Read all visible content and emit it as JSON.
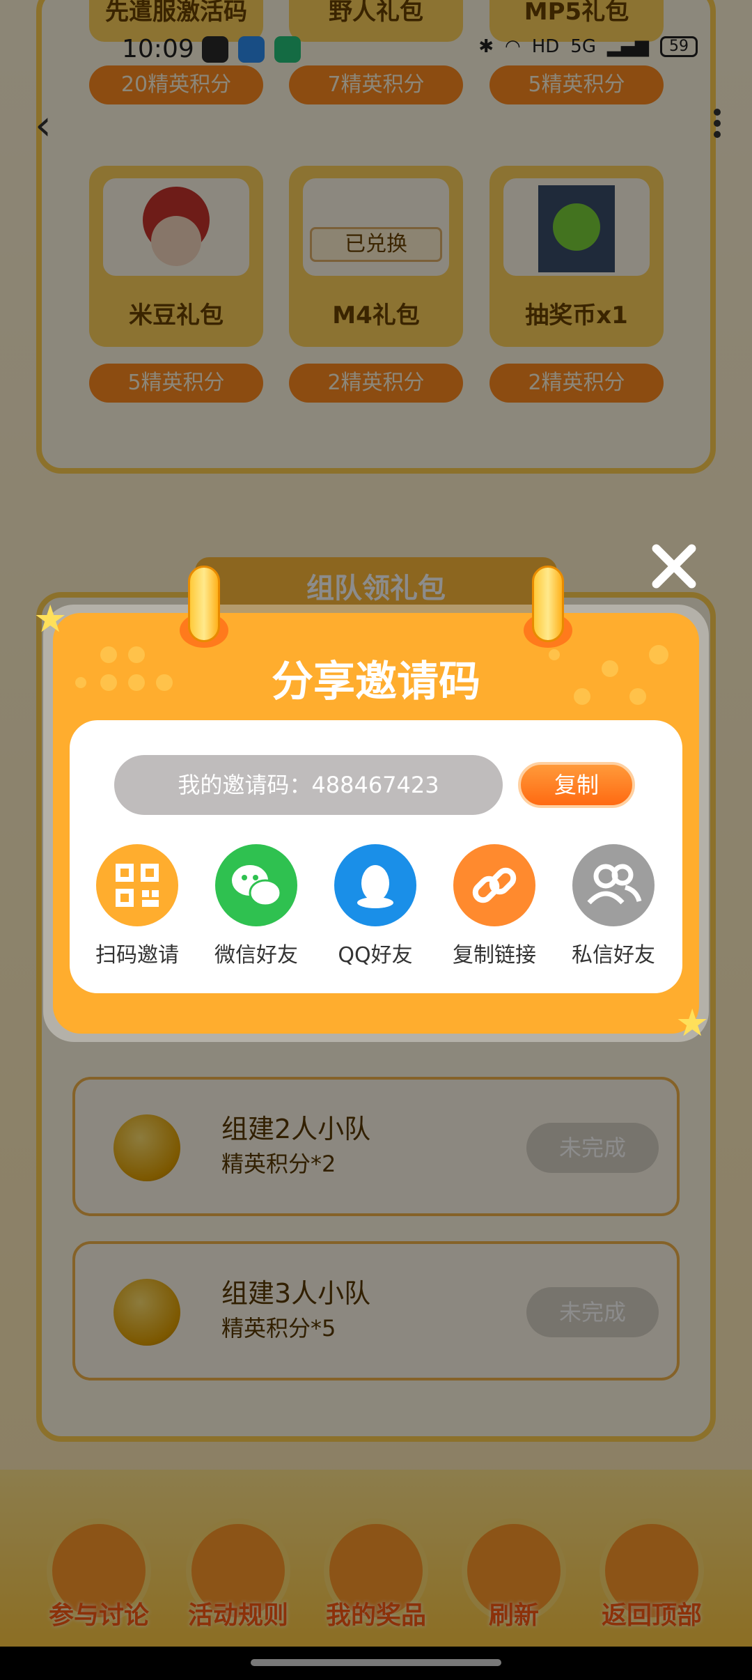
{
  "status_bar": {
    "time": "10:09",
    "network": "5G",
    "hd": "HD",
    "battery": "59"
  },
  "gift_top_row": [
    {
      "title": "先遣服激活码",
      "points": "20精英积分"
    },
    {
      "title": "野人礼包",
      "points": "7精英积分"
    },
    {
      "title": "MP5礼包",
      "points": "5精英积分"
    }
  ],
  "gift_row": [
    {
      "title": "米豆礼包",
      "points": "5精英积分"
    },
    {
      "title": "M4礼包",
      "points": "2精英积分",
      "tag": "已兑换"
    },
    {
      "title": "抽奖币x1",
      "points": "2精英积分"
    }
  ],
  "team_section": {
    "title": "组队领礼包",
    "tasks": [
      {
        "name": "组建2人小队",
        "reward": "精英积分*2",
        "status": "未完成"
      },
      {
        "name": "组建3人小队",
        "reward": "精英积分*5",
        "status": "未完成"
      }
    ]
  },
  "bottom_nav": [
    "参与讨论",
    "活动规则",
    "我的奖品",
    "刷新",
    "返回顶部"
  ],
  "modal": {
    "title": "分享邀请码",
    "code_label": "我的邀请码：488467423",
    "copy": "复制",
    "share_items": [
      {
        "label": "扫码邀请",
        "icon": "qr-code-icon",
        "color": "#ffad2e"
      },
      {
        "label": "微信好友",
        "icon": "wechat-icon",
        "color": "#2fc150"
      },
      {
        "label": "QQ好友",
        "icon": "qq-icon",
        "color": "#1a8fe8"
      },
      {
        "label": "复制链接",
        "icon": "link-icon",
        "color": "#ff8a2e"
      },
      {
        "label": "私信好友",
        "icon": "friends-icon",
        "color": "#9e9e9e"
      }
    ]
  }
}
